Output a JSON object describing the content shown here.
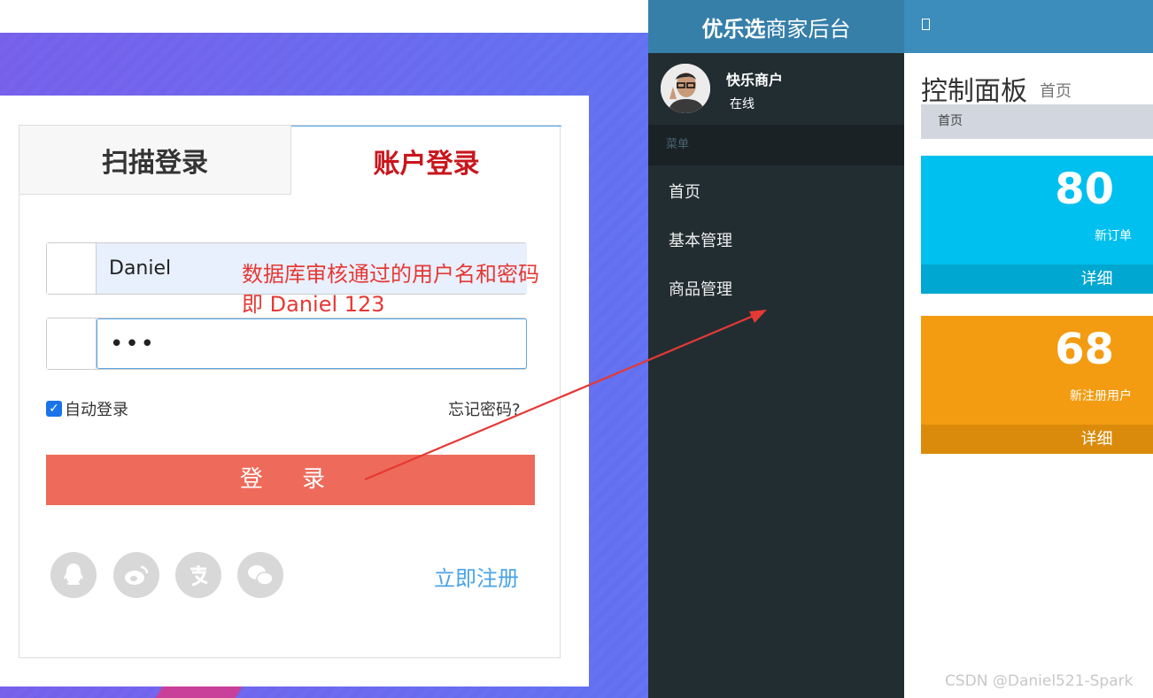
{
  "login": {
    "tab_scan": "扫描登录",
    "tab_account": "账户登录",
    "username_value": "Daniel",
    "password_value": "•••",
    "remember_label": "自动登录",
    "forget_label": "忘记密码?",
    "login_button": "登 录",
    "register_link": "立即注册",
    "social_icons": [
      "qq-icon",
      "weibo-icon",
      "alipay-icon",
      "wechat-icon"
    ]
  },
  "annotation": {
    "line1": "数据库审核通过的用户名和密码",
    "line2": "即 Daniel 123"
  },
  "sidebar": {
    "logo_bold": "优乐选",
    "logo_rest": "商家后台",
    "user_name": "快乐商户",
    "user_status": "在线",
    "menu_header": "菜单",
    "items": [
      {
        "label": "首页"
      },
      {
        "label": "基本管理"
      },
      {
        "label": "商品管理"
      }
    ]
  },
  "header": {
    "toggle_icon": "□"
  },
  "main": {
    "title": "控制面板",
    "subtitle": "首页",
    "breadcrumb": "首页",
    "boxes": [
      {
        "value": "80",
        "label": "新订单",
        "footer": "详细",
        "color": "#00c0ef"
      },
      {
        "value": "68",
        "label": "新注册用户",
        "footer": "详细",
        "color": "#f39c12"
      }
    ]
  },
  "watermark": "CSDN @Daniel521-Spark",
  "colors": {
    "accent_red": "#c8161d",
    "login_button": "#ee6a5b",
    "sidebar_bg": "#222d32",
    "header_blue": "#3c8dbc"
  }
}
